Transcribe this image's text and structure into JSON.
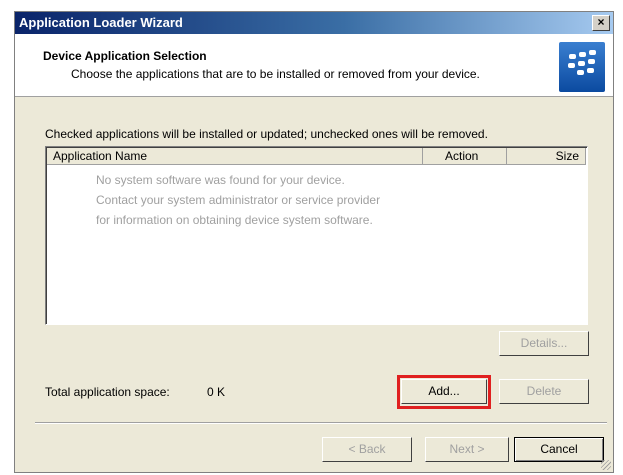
{
  "window": {
    "title": "Application Loader Wizard",
    "close_label": "×"
  },
  "header": {
    "title": "Device Application Selection",
    "subtitle": "Choose the applications that are to be installed or removed from your device.",
    "logo": "blackberry-logo"
  },
  "instructions": "Checked applications will be installed or updated; unchecked ones will be removed.",
  "table": {
    "columns": [
      "Application Name",
      "Action",
      "Size"
    ],
    "messages": [
      "No system software was found for your device.",
      "Contact your system administrator or service provider",
      "for information on obtaining device system software."
    ]
  },
  "buttons": {
    "details": "Details...",
    "add": "Add...",
    "delete": "Delete",
    "back": "< Back",
    "next": "Next >",
    "cancel": "Cancel"
  },
  "space": {
    "label": "Total application space:",
    "value": "0 K"
  },
  "colors": {
    "highlight": "#e02020",
    "title_bar": "#0a246a"
  }
}
